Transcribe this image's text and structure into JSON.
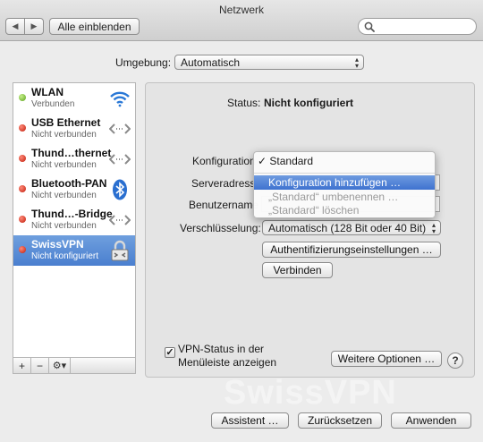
{
  "window": {
    "title": "Netzwerk"
  },
  "toolbar": {
    "back_glyph": "◀",
    "forward_glyph": "▶",
    "show_all_label": "Alle einblenden",
    "search_placeholder": ""
  },
  "location": {
    "label": "Umgebung:",
    "value": "Automatisch"
  },
  "services": [
    {
      "name": "WLAN",
      "status": "Verbunden",
      "state": "green",
      "icon": "wifi-icon"
    },
    {
      "name": "USB Ethernet",
      "status": "Nicht verbunden",
      "state": "red",
      "icon": "ethernet-arrows-icon"
    },
    {
      "name": "Thund…thernet",
      "status": "Nicht verbunden",
      "state": "red",
      "icon": "ethernet-arrows-icon"
    },
    {
      "name": "Bluetooth-PAN",
      "status": "Nicht verbunden",
      "state": "red",
      "icon": "bluetooth-icon"
    },
    {
      "name": "Thund…-Bridge",
      "status": "Nicht verbunden",
      "state": "red",
      "icon": "ethernet-arrows-icon"
    },
    {
      "name": "SwissVPN",
      "status": "Nicht konfiguriert",
      "state": "red",
      "icon": "vpn-lock-icon",
      "selected": true
    }
  ],
  "list_controls": {
    "add": "+",
    "remove": "−",
    "gear": "⚙▾"
  },
  "detail": {
    "status_label": "Status:",
    "status_value": "Nicht konfiguriert",
    "config_label": "Konfiguration",
    "server_label": "Serveradresse",
    "account_label": "Benutzername",
    "encryption_label": "Verschlüsselung:",
    "encryption_value": "Automatisch (128 Bit oder 40 Bit)",
    "auth_button": "Authentifizierungseinstellungen …",
    "connect_button": "Verbinden",
    "menubar_checkbox_line1": "VPN-Status in der",
    "menubar_checkbox_line2": "Menüleiste anzeigen",
    "menubar_checked": true,
    "advanced_button": "Weitere Optionen …",
    "help_glyph": "?"
  },
  "config_menu": {
    "items": [
      {
        "label": "✓ Standard",
        "state": "checked"
      },
      {
        "label": "Konfiguration hinzufügen …",
        "state": "highlighted"
      },
      {
        "label": "„Standard“ umbenennen …",
        "state": "disabled"
      },
      {
        "label": "„Standard“ löschen",
        "state": "disabled"
      }
    ]
  },
  "watermark": "SwissVPN",
  "footer": {
    "assistant_button": "Assistent …",
    "revert_button": "Zurücksetzen",
    "apply_button": "Anwenden"
  },
  "colors": {
    "selection": "#4a7fcf",
    "menu_highlight": "#3e72d0",
    "status_green": "#5aa21c",
    "status_red": "#c01a08"
  }
}
